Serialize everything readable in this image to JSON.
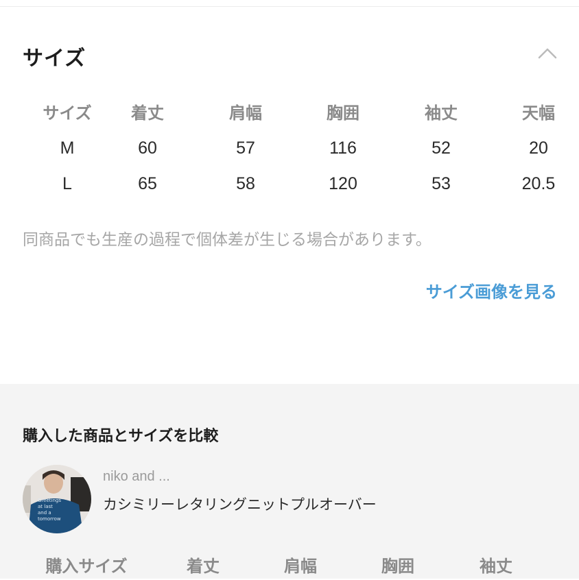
{
  "size_section": {
    "title": "サイズ",
    "collapse_icon": "chevron-up-icon",
    "columns": [
      "サイズ",
      "着丈",
      "肩幅",
      "胸囲",
      "袖丈",
      "天幅"
    ],
    "rows": [
      [
        "M",
        "60",
        "57",
        "116",
        "52",
        "20"
      ],
      [
        "L",
        "65",
        "58",
        "120",
        "53",
        "20.5"
      ]
    ],
    "note": "同商品でも生産の過程で個体差が生じる場合があります。",
    "size_image_link": "サイズ画像を見る",
    "link_color": "#4a9cd6"
  },
  "compare_section": {
    "title": "購入した商品とサイズを比較",
    "item": {
      "brand": "niko and ...",
      "name": "カシミリーレタリングニットプルオーバー",
      "thumbnail_text": [
        "Greetings",
        "at last",
        "and a",
        "tomorrow"
      ]
    },
    "columns": [
      "購入サイズ",
      "着丈",
      "肩幅",
      "胸囲",
      "袖丈"
    ],
    "background": "#f4f4f4"
  }
}
